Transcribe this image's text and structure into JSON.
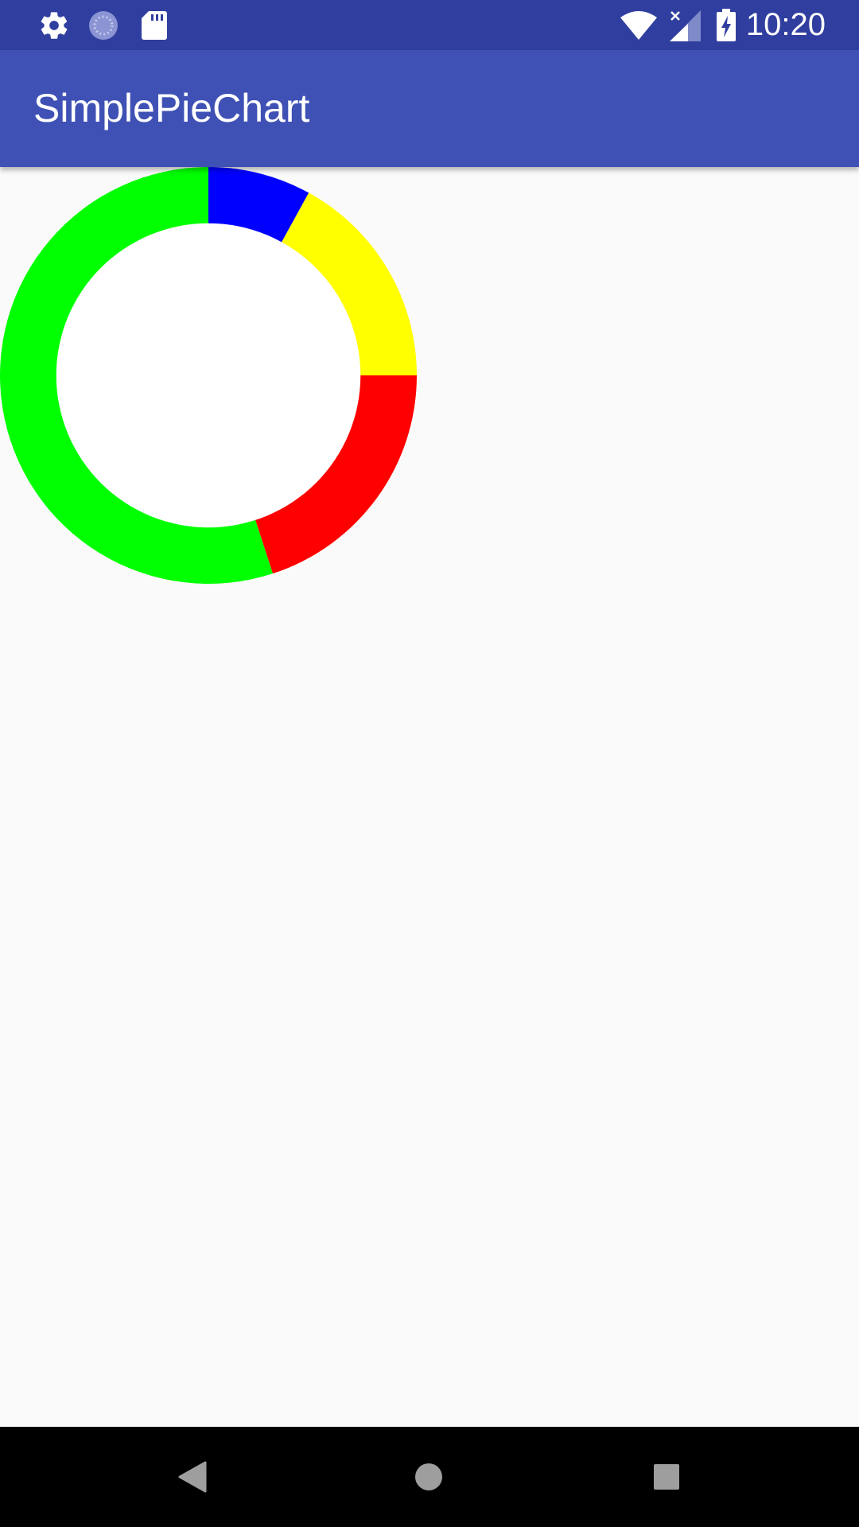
{
  "status_bar": {
    "time": "10:20",
    "icons": [
      "settings-icon",
      "sync-icon",
      "sd-card-icon",
      "wifi-icon",
      "no-signal-icon",
      "battery-charging-icon"
    ],
    "background": "#303f9f"
  },
  "app_bar": {
    "title": "SimplePieChart",
    "background": "#3f51b5"
  },
  "chart_data": {
    "type": "pie",
    "style": "donut",
    "start_angle_deg": 0,
    "direction": "clockwise",
    "inner_radius_ratio": 0.73,
    "slices": [
      {
        "value": 20,
        "color": "#ff0000"
      },
      {
        "value": 55,
        "color": "#00ff00"
      },
      {
        "value": 8,
        "color": "#0000ff"
      },
      {
        "value": 17,
        "color": "#ffff00"
      }
    ],
    "hole_color": "#ffffff"
  },
  "nav_bar": {
    "buttons": [
      "back-icon",
      "home-icon",
      "recents-icon"
    ],
    "background": "#000000"
  }
}
